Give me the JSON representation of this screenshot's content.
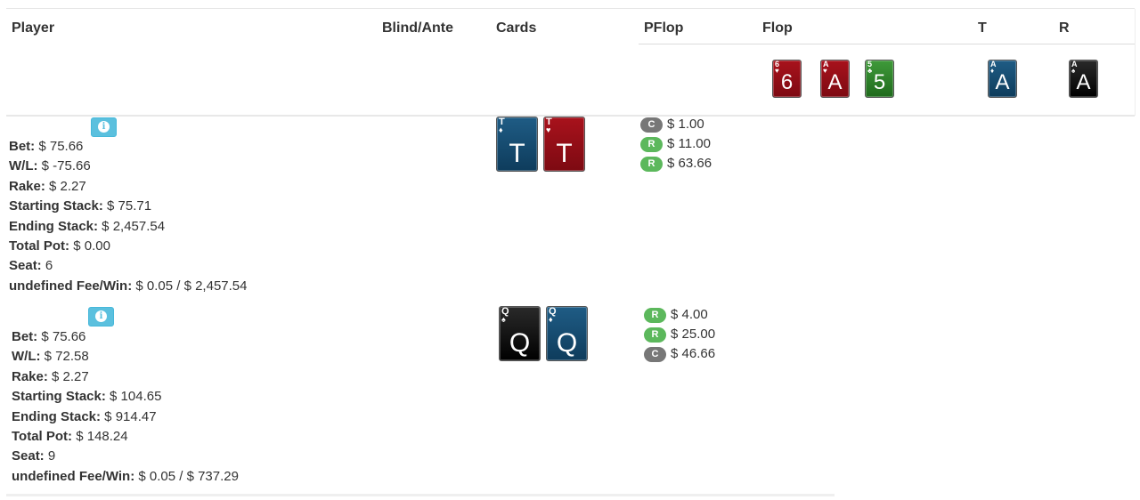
{
  "header": {
    "player": "Player",
    "blind_ante": "Blind/Ante",
    "cards": "Cards",
    "pflop": "PFlop",
    "flop": "Flop",
    "turn": "T",
    "river": "R"
  },
  "board": {
    "flop": [
      {
        "rank": "6",
        "suit": "♥",
        "color": "red"
      },
      {
        "rank": "A",
        "suit": "♥",
        "color": "red"
      },
      {
        "rank": "5",
        "suit": "♣",
        "color": "green"
      }
    ],
    "turn": {
      "rank": "A",
      "suit": "♦",
      "color": "blue"
    },
    "river": {
      "rank": "A",
      "suit": "♠",
      "color": "black"
    }
  },
  "colors": {
    "red": "#a8121c",
    "blue": "#1f5c85",
    "black": "#111111",
    "green": "#3f9a3a",
    "info": "#5bc0de",
    "raise": "#5cb85c",
    "call": "#777777"
  },
  "players": [
    {
      "info_icon": "info-icon",
      "cards": [
        {
          "rank": "T",
          "suit": "♦",
          "color": "blue"
        },
        {
          "rank": "T",
          "suit": "♥",
          "color": "red"
        }
      ],
      "pflop": [
        {
          "badge": "C",
          "amount": "$ 1.00"
        },
        {
          "badge": "R",
          "amount": "$ 11.00"
        },
        {
          "badge": "R",
          "amount": "$ 63.66"
        }
      ],
      "stats": [
        {
          "label": "Bet:",
          "value": " $ 75.66"
        },
        {
          "label": "W/L:",
          "value": " $ -75.66"
        },
        {
          "label": "Rake:",
          "value": " $ 2.27"
        },
        {
          "label": "Starting Stack:",
          "value": " $ 75.71"
        },
        {
          "label": "Ending Stack:",
          "value": " $ 2,457.54"
        },
        {
          "label": "Total Pot:",
          "value": " $ 0.00"
        },
        {
          "label": "Seat:",
          "value": " 6"
        },
        {
          "label": "undefined Fee/Win:",
          "value": " $ 0.05 / $ 2,457.54"
        }
      ]
    },
    {
      "info_icon": "info-icon",
      "cards": [
        {
          "rank": "Q",
          "suit": "♠",
          "color": "black"
        },
        {
          "rank": "Q",
          "suit": "♦",
          "color": "blue"
        }
      ],
      "pflop": [
        {
          "badge": "R",
          "amount": "$ 4.00"
        },
        {
          "badge": "R",
          "amount": "$ 25.00"
        },
        {
          "badge": "C",
          "amount": "$ 46.66"
        }
      ],
      "stats": [
        {
          "label": "Bet:",
          "value": " $ 75.66"
        },
        {
          "label": "W/L:",
          "value": " $ 72.58"
        },
        {
          "label": "Rake:",
          "value": " $ 2.27"
        },
        {
          "label": "Starting Stack:",
          "value": " $ 104.65"
        },
        {
          "label": "Ending Stack:",
          "value": " $ 914.47"
        },
        {
          "label": "Total Pot:",
          "value": " $ 148.24"
        },
        {
          "label": "Seat:",
          "value": " 9"
        },
        {
          "label": "undefined Fee/Win:",
          "value": " $ 0.05 / $ 737.29"
        }
      ]
    }
  ]
}
